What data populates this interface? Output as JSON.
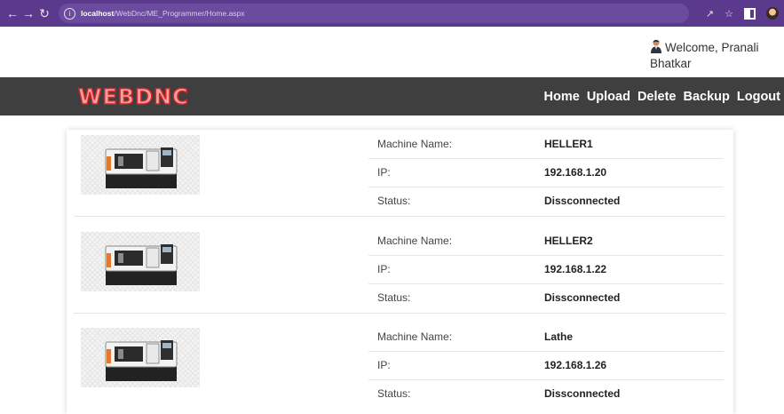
{
  "browser": {
    "url_host": "localhost",
    "url_path": "/WebDnc/ME_Programmer/Home.aspx"
  },
  "welcome": {
    "line1": "Welcome, Pranali",
    "line2": "Bhatkar"
  },
  "brand": {
    "logo_text": "WEBDNC"
  },
  "nav": {
    "home": "Home",
    "upload": "Upload",
    "delete": "Delete",
    "backup": "Backup",
    "logout": "Logout"
  },
  "machines": [
    {
      "name_label": "Machine Name:",
      "name": "HELLER1",
      "ip_label": "IP:",
      "ip": "192.168.1.20",
      "status_label": "Status:",
      "status": "Dissconnected"
    },
    {
      "name_label": "Machine Name:",
      "name": "HELLER2",
      "ip_label": "IP:",
      "ip": "192.168.1.22",
      "status_label": "Status:",
      "status": "Dissconnected"
    },
    {
      "name_label": "Machine Name:",
      "name": "Lathe",
      "ip_label": "IP:",
      "ip": "192.168.1.26",
      "status_label": "Status:",
      "status": "Dissconnected"
    }
  ],
  "colors": {
    "browser_bar": "#5b3a8e",
    "navbar": "#3f3f3f",
    "logo": "#d1262c"
  }
}
